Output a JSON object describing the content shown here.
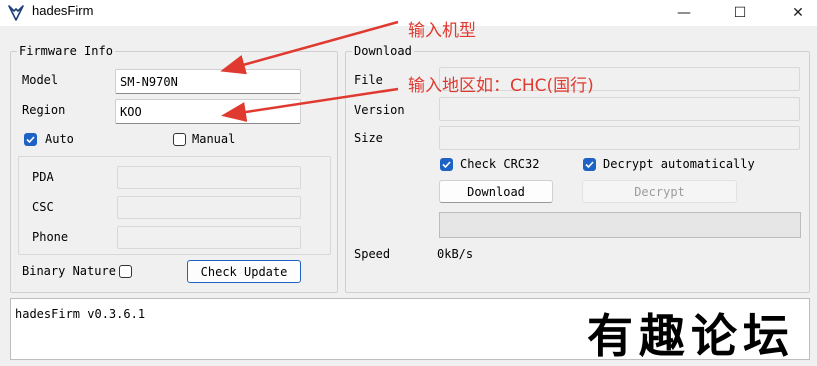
{
  "window": {
    "title": "hadesFirm",
    "minimize_glyph": "—",
    "maximize_glyph": "☐",
    "close_glyph": "✕"
  },
  "firmware_info": {
    "title": "Firmware Info",
    "model_label": "Model",
    "model_value": "SM-N970N",
    "region_label": "Region",
    "region_value": "KOO",
    "auto_label": "Auto",
    "auto_checked": true,
    "manual_label": "Manual",
    "manual_checked": false,
    "pda_label": "PDA",
    "pda_value": "",
    "csc_label": "CSC",
    "csc_value": "",
    "phone_label": "Phone",
    "phone_value": "",
    "binary_nature_label": "Binary Nature",
    "binary_nature_checked": false,
    "check_update_label": "Check Update"
  },
  "download": {
    "title": "Download",
    "file_label": "File",
    "file_value": "",
    "version_label": "Version",
    "version_value": "",
    "size_label": "Size",
    "size_value": "",
    "check_crc32_label": "Check CRC32",
    "check_crc32_checked": true,
    "decrypt_auto_label": "Decrypt automatically",
    "decrypt_auto_checked": true,
    "download_button_label": "Download",
    "decrypt_button_label": "Decrypt",
    "progress": 0,
    "speed_label": "Speed",
    "speed_value": "0kB/s"
  },
  "log": {
    "text": "hadesFirm v0.3.6.1"
  },
  "annotations": {
    "model_hint": "输入机型",
    "region_hint": "输入地区如：CHC(国行)",
    "color": "#e03a30"
  },
  "watermark": {
    "text": "有趣论坛"
  },
  "colors": {
    "accent": "#1f62c6",
    "window_bg": "#f0f0f0"
  }
}
